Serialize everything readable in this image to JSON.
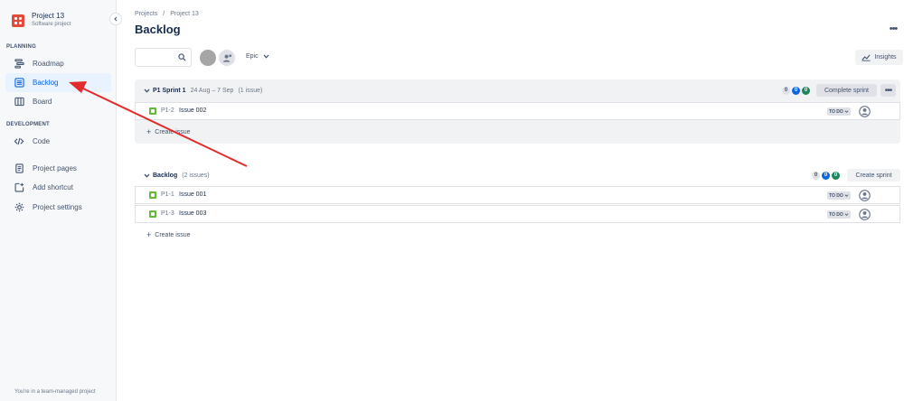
{
  "sidebar": {
    "project_name": "Project 13",
    "project_type": "Software project",
    "sections": {
      "planning": "PLANNING",
      "development": "DEVELOPMENT"
    },
    "items": {
      "roadmap": "Roadmap",
      "backlog": "Backlog",
      "board": "Board",
      "code": "Code",
      "project_pages": "Project pages",
      "add_shortcut": "Add shortcut",
      "project_settings": "Project settings"
    },
    "footer": "You're in a team-managed project"
  },
  "header": {
    "breadcrumb": {
      "root": "Projects",
      "sep": "/",
      "project": "Project 13"
    },
    "title": "Backlog"
  },
  "toolbar": {
    "search_placeholder": "",
    "epic_label": "Epic",
    "insights_label": "Insights"
  },
  "sprint": {
    "name": "P1 Sprint 1",
    "dates": "24 Aug – 7 Sep",
    "issue_count": "(1 issue)",
    "counts": {
      "todo": "0",
      "in_progress": "0",
      "done": "0"
    },
    "complete_label": "Complete sprint",
    "issues": [
      {
        "key": "P1-2",
        "summary": "Issue 002",
        "status": "TO DO"
      }
    ],
    "create_label": "Create issue"
  },
  "backlog": {
    "name": "Backlog",
    "issue_count": "(2 issues)",
    "counts": {
      "todo": "0",
      "in_progress": "0",
      "done": "0"
    },
    "create_sprint_label": "Create sprint",
    "issues": [
      {
        "key": "P1-1",
        "summary": "Issue 001",
        "status": "TO DO"
      },
      {
        "key": "P1-3",
        "summary": "Issue 003",
        "status": "TO DO"
      }
    ],
    "create_label": "Create issue"
  },
  "colors": {
    "accent": "#0c66e4",
    "annotation_arrow": "#e32b2b",
    "story": "#63ba3c",
    "done": "#1f845a"
  }
}
